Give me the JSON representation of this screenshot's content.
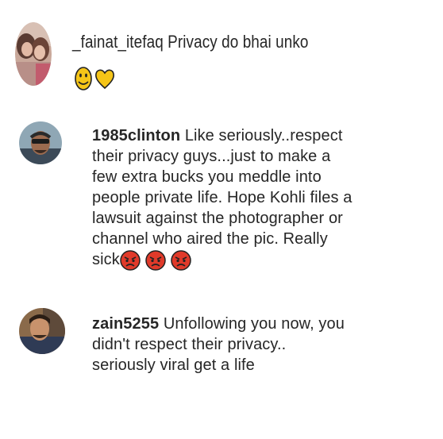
{
  "comments": [
    {
      "username": "_fainat_itefaq",
      "text": "Privacy do bhai unko",
      "emojis": [
        "slightly-smiling-face",
        "yellow-heart"
      ]
    },
    {
      "username": "1985clinton",
      "text_lines": [
        "Like seriously..respect",
        "their privacy guys...just to make a",
        "few extra bucks you meddle into",
        "people private life. Hope Kohli files a",
        "lawsuit against the photographer or",
        "channel who aired the pic. Really",
        "sick"
      ],
      "emojis": [
        "angry-face",
        "angry-face",
        "angry-face"
      ]
    },
    {
      "username": "zain5255",
      "text_lines": [
        "Unfollowing you now, you",
        "didn't respect their privacy..",
        "seriously viral get a life"
      ]
    }
  ],
  "colors": {
    "text": "#262626",
    "background": "#ffffff",
    "emoji_yellow": "#f5c518",
    "emoji_angry": "#e03a2a"
  }
}
